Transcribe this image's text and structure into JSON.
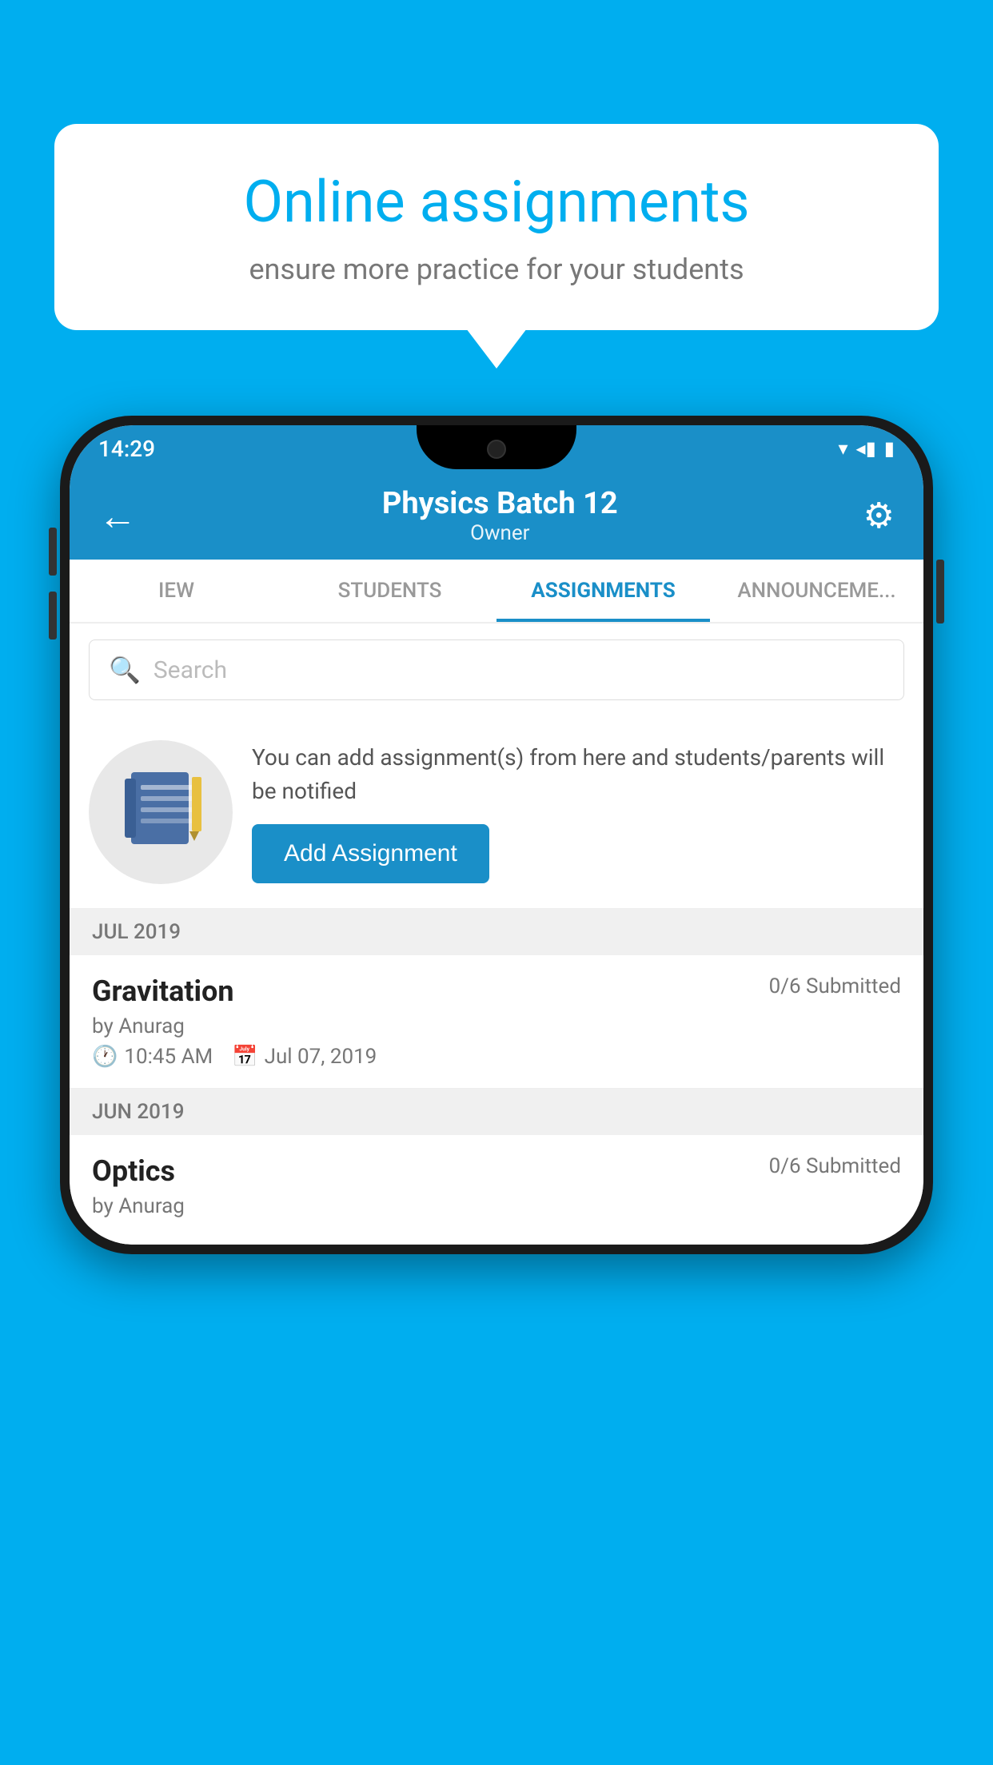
{
  "background_color": "#00AEEF",
  "bubble": {
    "title": "Online assignments",
    "subtitle": "ensure more practice for your students"
  },
  "status_bar": {
    "time": "14:29",
    "wifi_icon": "▾",
    "signal_icon": "◂",
    "battery_icon": "▮"
  },
  "app_bar": {
    "title": "Physics Batch 12",
    "subtitle": "Owner",
    "back_icon": "←",
    "settings_icon": "⚙"
  },
  "tabs": [
    {
      "label": "IEW",
      "active": false
    },
    {
      "label": "STUDENTS",
      "active": false
    },
    {
      "label": "ASSIGNMENTS",
      "active": true
    },
    {
      "label": "ANNOUNCEMENTS",
      "active": false
    }
  ],
  "search": {
    "placeholder": "Search"
  },
  "promo": {
    "text": "You can add assignment(s) from here and students/parents will be notified",
    "button_label": "Add Assignment"
  },
  "sections": [
    {
      "month": "JUL 2019",
      "assignments": [
        {
          "name": "Gravitation",
          "submitted": "0/6 Submitted",
          "author": "by Anurag",
          "time": "10:45 AM",
          "date": "Jul 07, 2019"
        }
      ]
    },
    {
      "month": "JUN 2019",
      "assignments": [
        {
          "name": "Optics",
          "submitted": "0/6 Submitted",
          "author": "by Anurag",
          "time": "",
          "date": ""
        }
      ]
    }
  ]
}
